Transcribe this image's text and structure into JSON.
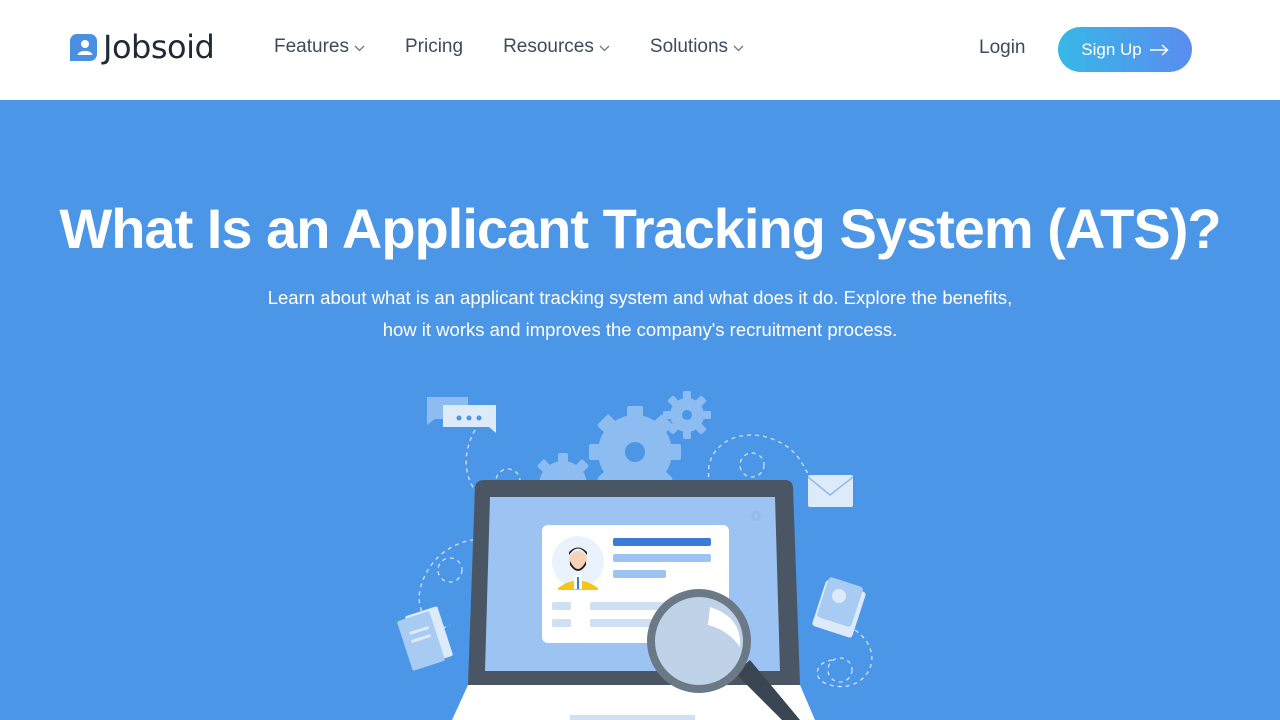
{
  "brand": {
    "name": "Jobsoid",
    "accent": "#4a90e2"
  },
  "nav": {
    "items": [
      {
        "label": "Features",
        "has_dropdown": true
      },
      {
        "label": "Pricing",
        "has_dropdown": false
      },
      {
        "label": "Resources",
        "has_dropdown": true
      },
      {
        "label": "Solutions",
        "has_dropdown": true
      }
    ],
    "login": "Login",
    "signup": "Sign Up"
  },
  "hero": {
    "title": "What Is an Applicant Tracking System (ATS)?",
    "subtitle_line1": "Learn about what is an applicant tracking system and what does it do. Explore the benefits,",
    "subtitle_line2": "how it works and improves the company's recruitment process.",
    "background": "#4b96e6"
  },
  "illustration": {
    "icons": [
      "chat-bubble-icon",
      "gear-icon",
      "envelope-icon",
      "laptop-icon",
      "profile-card-icon",
      "magnifier-icon",
      "document-icon",
      "photo-icon"
    ]
  }
}
